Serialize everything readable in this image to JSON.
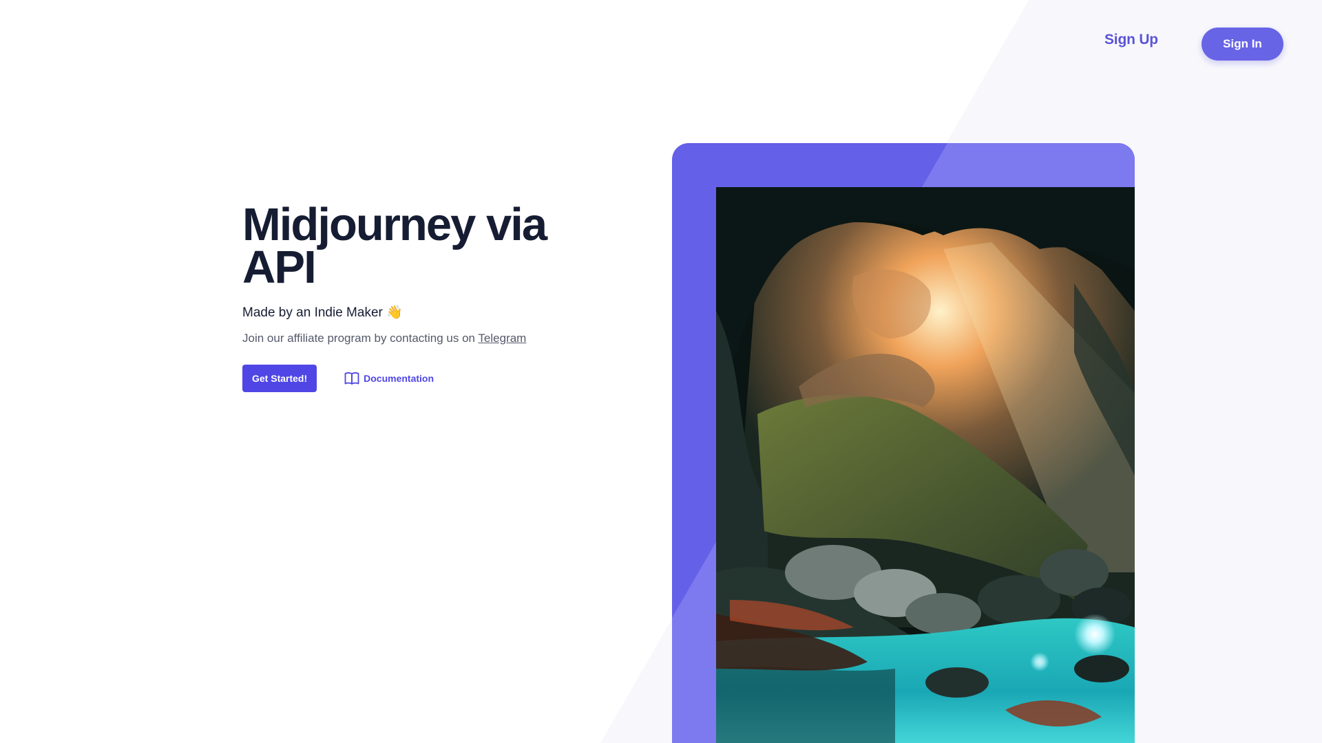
{
  "header": {
    "signup_label": "Sign Up",
    "signin_label": "Sign In"
  },
  "hero": {
    "title_line1": "Midjourney via",
    "title_line2": "API",
    "subtitle": "Made by an Indie Maker 👋",
    "affiliate_text": "Join our affiliate program by contacting us on ",
    "telegram_label": "Telegram",
    "get_started_label": "Get Started!",
    "docs_label": "Documentation",
    "docs_icon": "book-icon",
    "image": "cave-waterfall-illustration"
  },
  "colors": {
    "accent": "#4f46e5",
    "signin_bg": "#6864e6",
    "frame": "#6560e8",
    "title": "#161d33"
  }
}
